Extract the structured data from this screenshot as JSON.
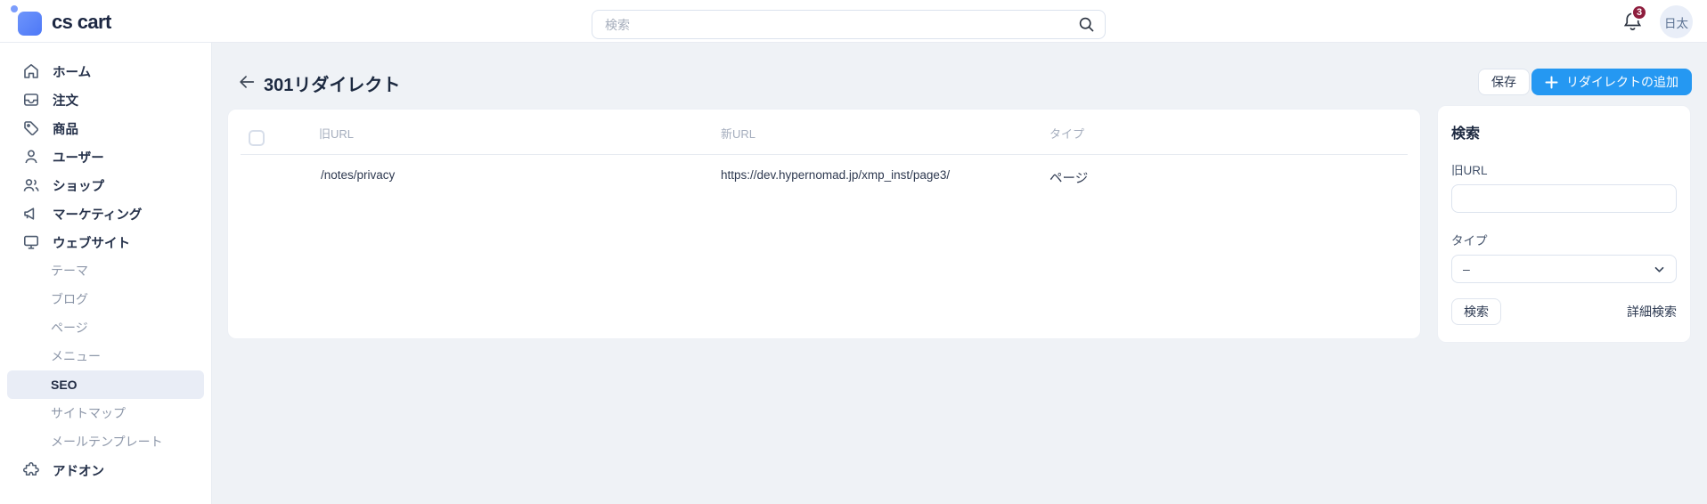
{
  "topbar": {
    "logo_text": "cs cart",
    "search_placeholder": "検索",
    "notification_count": "3",
    "avatar_text": "日太"
  },
  "sidebar": {
    "items": [
      {
        "label": "ホーム",
        "icon": "home-icon"
      },
      {
        "label": "注文",
        "icon": "orders-icon"
      },
      {
        "label": "商品",
        "icon": "products-icon"
      },
      {
        "label": "ユーザー",
        "icon": "user-icon"
      },
      {
        "label": "ショップ",
        "icon": "shops-icon"
      },
      {
        "label": "マーケティング",
        "icon": "marketing-icon"
      },
      {
        "label": "ウェブサイト",
        "icon": "website-icon"
      },
      {
        "label": "テーマ"
      },
      {
        "label": "ブログ"
      },
      {
        "label": "ページ"
      },
      {
        "label": "メニュー"
      },
      {
        "label": "SEO",
        "active": true
      },
      {
        "label": "サイトマップ"
      },
      {
        "label": "メールテンプレート"
      },
      {
        "label": "アドオン",
        "icon": "addons-icon"
      }
    ]
  },
  "page": {
    "title": "301リダイレクト",
    "save_button": "保存",
    "add_button": "リダイレクトの追加"
  },
  "table": {
    "columns": {
      "old": "旧URL",
      "new": "新URL",
      "type": "タイプ"
    },
    "rows": [
      {
        "old_url": "/notes/privacy",
        "new_url": "https://dev.hypernomad.jp/xmp_inst/page3/",
        "type": "ページ"
      }
    ]
  },
  "filter": {
    "title": "検索",
    "old_url_label": "旧URL",
    "old_url_value": "",
    "type_label": "タイプ",
    "type_value": "–",
    "search_button": "検索",
    "advanced_link": "詳細検索"
  },
  "colors": {
    "accent_blue": "#2598f2",
    "badge_red": "#8e1d3d",
    "logo_blue": "#4d78f7",
    "background": "#eff2f6",
    "active_item_bg": "#e9edf6"
  }
}
